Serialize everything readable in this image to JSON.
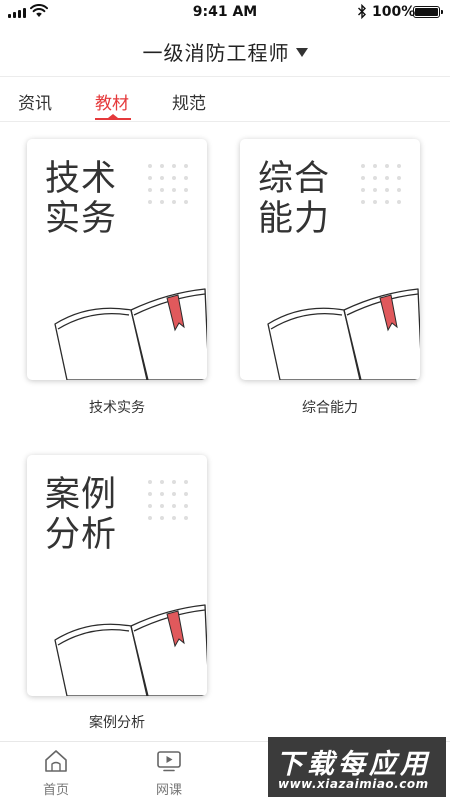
{
  "status_bar": {
    "time": "9:41 AM",
    "battery_percent": "100%",
    "battery_level": 1.0,
    "icons": [
      "signal-icon",
      "wifi-icon",
      "bluetooth-icon",
      "battery-icon"
    ]
  },
  "header": {
    "title": "一级消防工程师",
    "dropdown_icon": "triangle-down"
  },
  "tabs": [
    {
      "label": "资讯",
      "active": false
    },
    {
      "label": "教材",
      "active": true
    },
    {
      "label": "规范",
      "active": false
    }
  ],
  "books": [
    {
      "cover_title": "技术实务",
      "label": "技术实务"
    },
    {
      "cover_title": "综合能力",
      "label": "综合能力"
    },
    {
      "cover_title": "案例分析",
      "label": "案例分析"
    }
  ],
  "bottom_nav": {
    "items": [
      {
        "label": "首页",
        "icon": "home-icon"
      },
      {
        "label": "网课",
        "icon": "video-icon"
      }
    ]
  },
  "watermark": {
    "main": "下载每应用",
    "url": "www.xiazaimiao.com"
  },
  "colors": {
    "accent": "#e5393b",
    "text": "#333333",
    "bookmark": "#e0595c"
  }
}
